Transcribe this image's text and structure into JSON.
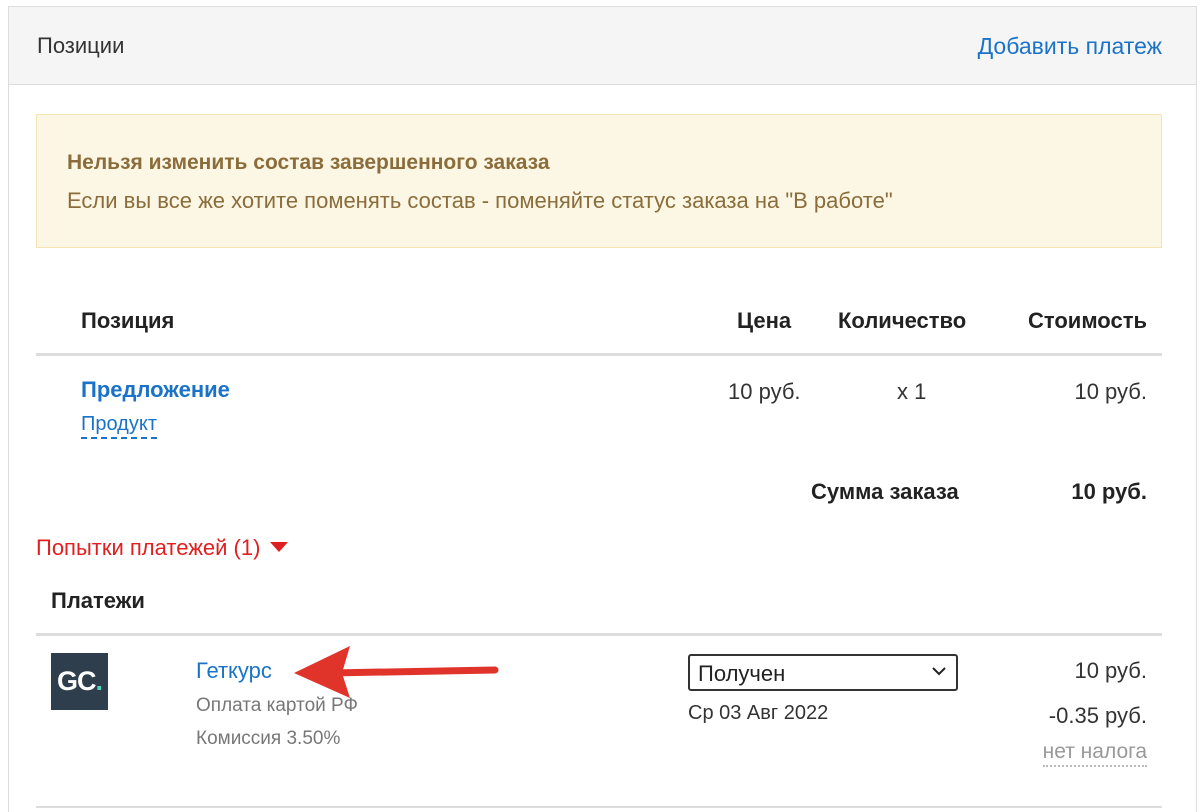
{
  "header": {
    "title": "Позиции",
    "add_payment": "Добавить платеж"
  },
  "alert": {
    "title": "Нельзя изменить состав завершенного заказа",
    "text": "Если вы все же хотите поменять состав - поменяйте статус заказа на \"В работе\""
  },
  "table": {
    "columns": {
      "position": "Позиция",
      "price": "Цена",
      "quantity": "Количество",
      "cost": "Стоимость"
    },
    "rows": [
      {
        "name": "Предложение",
        "type": "Продукт",
        "price": "10 руб.",
        "quantity": "x 1",
        "cost": "10 руб."
      }
    ],
    "total_label": "Сумма заказа",
    "total_value": "10 руб."
  },
  "attempts": {
    "label": "Попытки платежей (1)"
  },
  "payments": {
    "title": "Платежи",
    "items": [
      {
        "logo_text": "GC",
        "logo_dot": ".",
        "provider": "Геткурс",
        "method": "Оплата картой РФ",
        "fee": "Комиссия 3.50%",
        "status": "Получен",
        "date": "Ср 03 Авг 2022",
        "amount": "10 руб.",
        "commission": "-0.35 руб.",
        "tax": "нет налога"
      }
    ]
  },
  "colors": {
    "link": "#1a73c8",
    "alert_bg": "#fcf6e4",
    "alert_text": "#8a6d3b",
    "danger": "#e02020",
    "arrow": "#e0342b",
    "logo_bg": "#2f3e4c",
    "logo_accent": "#4fd3b9"
  }
}
